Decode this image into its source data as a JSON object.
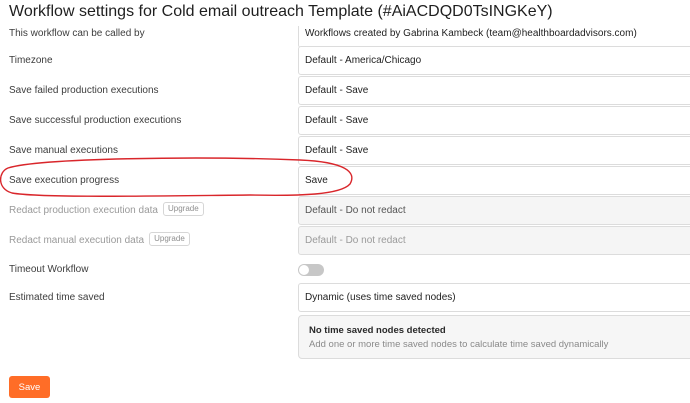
{
  "header": {
    "title": "Workflow settings for Cold email outreach Template (#AiACDQD0TsINGKeY)"
  },
  "rows": {
    "caller": {
      "label": "This workflow can be called by",
      "value": "Workflows created by Gabrina Kambeck (team@healthboardadvisors.com)"
    },
    "timezone": {
      "label": "Timezone",
      "value": "Default - America/Chicago"
    },
    "save_failed": {
      "label": "Save failed production executions",
      "value": "Default - Save"
    },
    "save_successful": {
      "label": "Save successful production executions",
      "value": "Default - Save"
    },
    "save_manual": {
      "label": "Save manual executions",
      "value": "Default - Save"
    },
    "save_progress": {
      "label": "Save execution progress",
      "value": "Save"
    },
    "redact_production": {
      "label": "Redact production execution data",
      "badge": "Upgrade",
      "value": "Default - Do not redact"
    },
    "redact_manual": {
      "label": "Redact manual execution data",
      "badge": "Upgrade",
      "value": "Default - Do not redact"
    },
    "timeout": {
      "label": "Timeout Workflow",
      "enabled": false
    },
    "time_saved": {
      "label": "Estimated time saved",
      "value": "Dynamic (uses time saved nodes)"
    }
  },
  "notice": {
    "title": "No time saved nodes detected",
    "description": "Add one or more time saved nodes to calculate time saved dynamically"
  },
  "footer": {
    "save_label": "Save"
  },
  "colors": {
    "accent": "#ff6d27",
    "annotation": "#d9262b"
  }
}
